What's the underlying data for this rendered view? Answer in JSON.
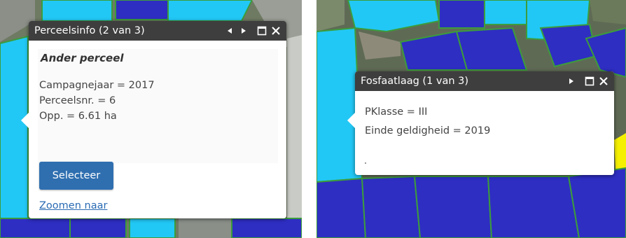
{
  "left_popup": {
    "title": "Perceelsinfo (2 van 3)",
    "heading": "Ander perceel",
    "fields": [
      "Campagnejaar = 2017",
      "Perceelsnr. = 6",
      "Opp. = 6.61 ha"
    ],
    "select_button": "Selecteer",
    "zoom_link": "Zoomen naar",
    "toolbar_icons": [
      "previous-icon",
      "next-icon",
      "maximize-icon",
      "close-icon"
    ]
  },
  "right_popup": {
    "title": "Fosfaatlaag (1 van 3)",
    "fields": [
      "PKlasse = III",
      "Einde geldigheid = 2019"
    ],
    "toolbar_icons": [
      "next-icon",
      "maximize-icon",
      "close-icon"
    ]
  },
  "colors": {
    "light_blue_parcel": "#22c8f5",
    "dark_blue_parcel": "#2e2ec2",
    "parcel_border": "#3c9c3c",
    "title_bar": "#3e3e3e",
    "select_button": "#2f6fb0",
    "link": "#2a6bb3",
    "yellow_parcel": "#f5f000"
  }
}
